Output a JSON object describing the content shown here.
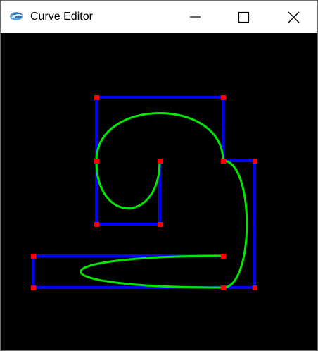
{
  "window": {
    "title": "Curve Editor",
    "controls": {
      "minimize": "minimize-icon",
      "maximize": "maximize-icon",
      "close": "close-icon"
    }
  },
  "colors": {
    "titlebar_bg": "#ffffff",
    "canvas_bg": "#000000",
    "control_polygon": "#0000ff",
    "curve": "#00e600",
    "control_point": "#ff0000",
    "icon": "#000000"
  },
  "icons": {
    "app": "app-logo-icon"
  }
}
